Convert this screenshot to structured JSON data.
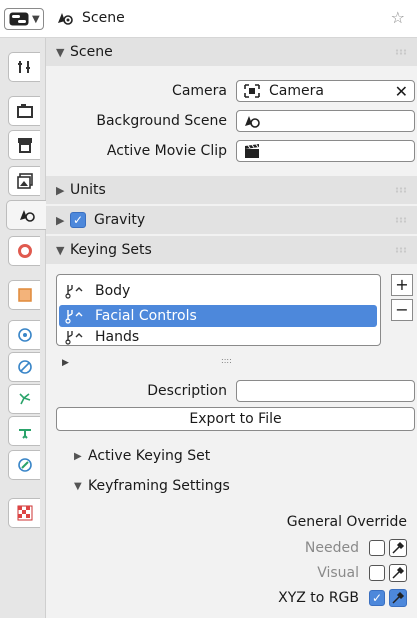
{
  "header": {
    "title": "Scene"
  },
  "sections": {
    "scene": "Scene",
    "units": "Units",
    "gravity": "Gravity",
    "keying_sets": "Keying Sets"
  },
  "scene": {
    "camera_label": "Camera",
    "camera_value": "Camera",
    "background_scene_label": "Background Scene",
    "background_scene_value": "",
    "active_movie_clip_label": "Active Movie Clip",
    "active_movie_clip_value": ""
  },
  "gravity_enabled": true,
  "keying_sets": {
    "items": [
      "Body",
      "Facial Controls",
      "Hands"
    ],
    "selected": "Facial Controls",
    "add_label": "+",
    "remove_label": "−",
    "description_label": "Description",
    "description_value": "",
    "export_label": "Export to File",
    "active_keying_set_label": "Active Keying Set",
    "keyframing_settings_label": "Keyframing Settings"
  },
  "general_override": {
    "title": "General Override",
    "needed_label": "Needed",
    "visual_label": "Visual",
    "xyz_to_rgb_label": "XYZ to RGB",
    "needed": false,
    "visual": false,
    "xyz_to_rgb": true
  },
  "colors": {
    "accent": "#4d88db",
    "selected_row": "#4d88db"
  }
}
